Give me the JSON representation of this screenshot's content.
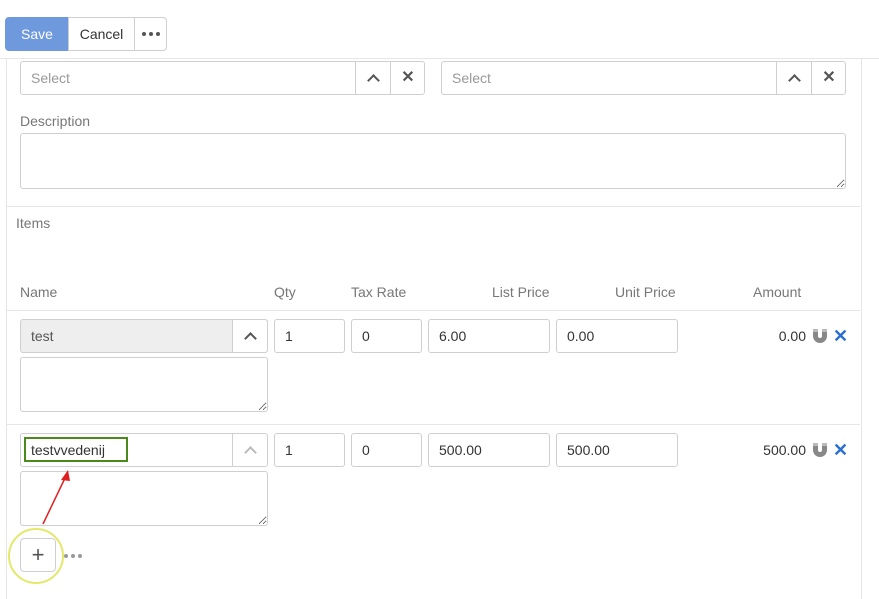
{
  "toolbar": {
    "save_label": "Save",
    "cancel_label": "Cancel"
  },
  "selects": [
    {
      "placeholder": "Select"
    },
    {
      "placeholder": "Select"
    }
  ],
  "description": {
    "label": "Description",
    "value": ""
  },
  "items": {
    "label": "Items",
    "columns": {
      "name": "Name",
      "qty": "Qty",
      "tax_rate": "Tax Rate",
      "list_price": "List Price",
      "unit_price": "Unit Price",
      "amount": "Amount"
    },
    "rows": [
      {
        "name": "test",
        "qty": "1",
        "tax_rate": "0",
        "list_price": "6.00",
        "unit_price": "0.00",
        "amount": "0.00",
        "description": ""
      },
      {
        "name": "testvvedenij",
        "qty": "1",
        "tax_rate": "0",
        "list_price": "500.00",
        "unit_price": "500.00",
        "amount": "500.00",
        "description": ""
      }
    ]
  },
  "icons": {
    "more": "more-horizontal-icon",
    "collapse": "chevron-up-icon",
    "clear": "close-icon",
    "magnet": "magnet-icon",
    "remove": "remove-icon",
    "add": "plus-icon"
  },
  "colors": {
    "accent": "#6f99dd",
    "remove": "#2a6fcf",
    "highlight_box": "#4a8a1a",
    "annotation_arrow": "#e02020",
    "annotation_circle": "#e4e86a"
  }
}
